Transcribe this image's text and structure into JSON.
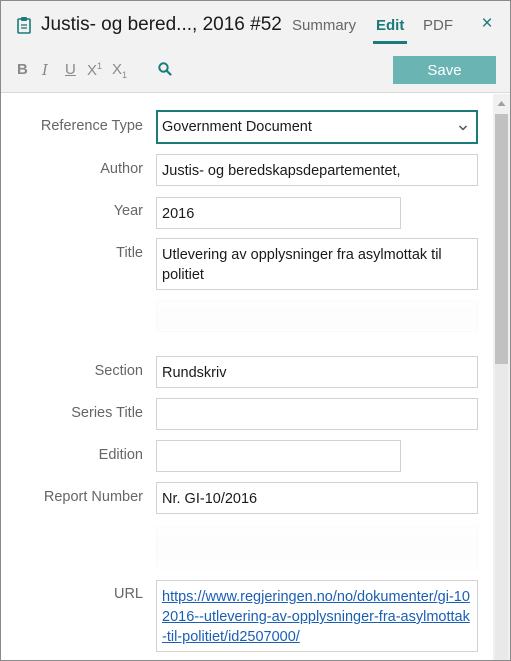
{
  "header": {
    "title": "Justis- og bered..., 2016 #52",
    "tabs": {
      "summary": "Summary",
      "edit": "Edit",
      "pdf": "PDF"
    },
    "close_label": "×",
    "icons": {
      "document": "clipboard-icon",
      "close": "close-icon",
      "search": "search-icon"
    }
  },
  "toolbar": {
    "bold": "B",
    "italic": "I",
    "underline": "U",
    "superscript": "X",
    "superscript_mark": "1",
    "subscript": "X",
    "subscript_mark": "1",
    "save_label": "Save"
  },
  "form": {
    "reference_type": {
      "label": "Reference Type",
      "value": "Government Document"
    },
    "author": {
      "label": "Author",
      "value": "Justis- og beredskapsdepartementet,"
    },
    "year": {
      "label": "Year",
      "value": "2016"
    },
    "title": {
      "label": "Title",
      "value": "Utlevering av opplysninger fra asylmottak til politiet"
    },
    "section": {
      "label": "Section",
      "value": "Rundskriv"
    },
    "series_title": {
      "label": "Series Title",
      "value": ""
    },
    "edition": {
      "label": "Edition",
      "value": ""
    },
    "report_number": {
      "label": "Report Number",
      "value": "Nr. GI-10/2016"
    },
    "url": {
      "label": "URL",
      "value": "https://www.regjeringen.no/no/dokumenter/gi-102016--utlevering-av-opplysninger-fra-asylmottak-til-politiet/id2507000/"
    }
  },
  "colors": {
    "accent": "#1b7a7a",
    "save_button": "#6bb4b4",
    "link": "#1a5fb4"
  }
}
